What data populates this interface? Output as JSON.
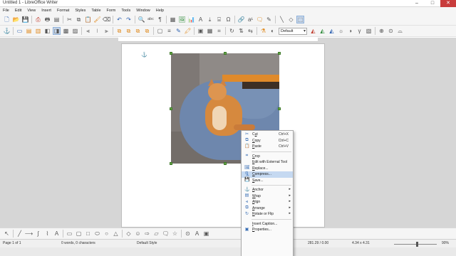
{
  "window": {
    "title": "Untitled 1 - LibreOffice Writer",
    "controls": [
      "–",
      "□",
      "✕"
    ]
  },
  "menubar": [
    "File",
    "Edit",
    "View",
    "Insert",
    "Format",
    "Styles",
    "Table",
    "Form",
    "Tools",
    "Window",
    "Help"
  ],
  "toolbar_top": [
    {
      "name": "new-document-icon",
      "glyph": "🗋",
      "tone": "blue"
    },
    {
      "name": "open-icon",
      "glyph": "📂",
      "tone": "orange"
    },
    {
      "name": "save-icon",
      "glyph": "💾",
      "tone": "blue"
    },
    {
      "sep": true
    },
    {
      "name": "export-pdf-icon",
      "glyph": "⎙",
      "tone": "red"
    },
    {
      "name": "print-icon",
      "glyph": "🖶",
      "tone": ""
    },
    {
      "name": "print-preview-icon",
      "glyph": "▤",
      "tone": ""
    },
    {
      "sep": true
    },
    {
      "name": "cut-icon",
      "glyph": "✂",
      "tone": ""
    },
    {
      "name": "copy-icon",
      "glyph": "⧉",
      "tone": ""
    },
    {
      "name": "paste-icon",
      "glyph": "📋",
      "tone": "orange"
    },
    {
      "name": "clone-formatting-icon",
      "glyph": "🖌",
      "tone": "orange"
    },
    {
      "name": "clear-formatting-icon",
      "glyph": "⌫",
      "tone": ""
    },
    {
      "sep": true
    },
    {
      "name": "undo-icon",
      "glyph": "↶",
      "tone": "blue"
    },
    {
      "name": "redo-icon",
      "glyph": "↷",
      "tone": "blue"
    },
    {
      "sep": true
    },
    {
      "name": "find-replace-icon",
      "glyph": "🔍",
      "tone": ""
    },
    {
      "name": "spelling-icon",
      "glyph": "ᵃᵇᶜ",
      "tone": ""
    },
    {
      "name": "formatting-marks-icon",
      "glyph": "¶",
      "tone": ""
    },
    {
      "sep": true
    },
    {
      "name": "insert-table-icon",
      "glyph": "▦",
      "tone": ""
    },
    {
      "name": "insert-image-icon",
      "glyph": "🖼",
      "tone": "green"
    },
    {
      "name": "insert-chart-icon",
      "glyph": "📊",
      "tone": "blue"
    },
    {
      "name": "insert-textbox-icon",
      "glyph": "A",
      "tone": ""
    },
    {
      "name": "insert-page-break-icon",
      "glyph": "⤓",
      "tone": ""
    },
    {
      "name": "insert-field-icon",
      "glyph": "⌸",
      "tone": ""
    },
    {
      "name": "insert-special-char-icon",
      "glyph": "Ω",
      "tone": ""
    },
    {
      "sep": true
    },
    {
      "name": "hyperlink-icon",
      "glyph": "🔗",
      "tone": "blue"
    },
    {
      "name": "footnote-icon",
      "glyph": "a¹",
      "tone": ""
    },
    {
      "name": "comment-icon",
      "glyph": "🗨",
      "tone": "orange"
    },
    {
      "name": "track-changes-icon",
      "glyph": "✎",
      "tone": ""
    },
    {
      "sep": true
    },
    {
      "name": "insert-line-icon",
      "glyph": "╲",
      "tone": ""
    },
    {
      "name": "basic-shapes-icon",
      "glyph": "◇",
      "tone": ""
    },
    {
      "name": "show-draw-functions-icon",
      "glyph": "⬚",
      "tone": "",
      "active": true
    }
  ],
  "toolbar_frame": [
    {
      "name": "anchor-icon",
      "glyph": "⚓",
      "tone": "blue"
    },
    {
      "sep": true
    },
    {
      "name": "wrap-off-icon",
      "glyph": "▭",
      "tone": "blue"
    },
    {
      "name": "page-wrap-icon",
      "glyph": "▤",
      "tone": "orange"
    },
    {
      "name": "optimal-wrap-icon",
      "glyph": "▥",
      "tone": "orange"
    },
    {
      "name": "wrap-left-icon",
      "glyph": "◧",
      "tone": ""
    },
    {
      "name": "wrap-right-icon",
      "glyph": "◨",
      "tone": "",
      "active": true
    },
    {
      "name": "wrap-through-icon",
      "glyph": "▩",
      "tone": ""
    },
    {
      "name": "in-background-icon",
      "glyph": "▨",
      "tone": ""
    },
    {
      "sep": true
    },
    {
      "name": "align-left-icon",
      "glyph": "⫷",
      "tone": ""
    },
    {
      "name": "align-center-icon",
      "glyph": "⧙",
      "tone": ""
    },
    {
      "name": "align-right-icon",
      "glyph": "⫸",
      "tone": ""
    },
    {
      "sep": true
    },
    {
      "name": "bring-to-front-icon",
      "glyph": "⧉",
      "tone": "orange"
    },
    {
      "name": "bring-forward-icon",
      "glyph": "⧉",
      "tone": "orange"
    },
    {
      "name": "send-backward-icon",
      "glyph": "⧉",
      "tone": "orange"
    },
    {
      "name": "send-to-back-icon",
      "glyph": "⧉",
      "tone": "orange"
    },
    {
      "sep": true
    },
    {
      "name": "border-icon",
      "glyph": "▢",
      "tone": ""
    },
    {
      "name": "border-style-icon",
      "glyph": "≡",
      "tone": ""
    },
    {
      "name": "border-color-icon",
      "glyph": "✎",
      "tone": "blue"
    },
    {
      "name": "background-color-icon",
      "glyph": "🖍",
      "tone": "orange"
    },
    {
      "sep": true
    },
    {
      "name": "frame-properties-icon",
      "glyph": "▣",
      "tone": ""
    },
    {
      "name": "image-properties-icon",
      "glyph": "▦",
      "tone": ""
    },
    {
      "name": "crop-icon",
      "glyph": "⌗",
      "tone": ""
    },
    {
      "sep": true
    },
    {
      "name": "rotate-icon",
      "glyph": "↻",
      "tone": ""
    },
    {
      "name": "flip-vertical-icon",
      "glyph": "⇅",
      "tone": ""
    },
    {
      "name": "flip-horizontal-icon",
      "glyph": "⇆",
      "tone": ""
    },
    {
      "sep": true
    },
    {
      "name": "image-filter-icon",
      "glyph": "⚗",
      "tone": "orange"
    },
    {
      "name": "graphics-mode-icon",
      "glyph": "◐",
      "tone": ""
    },
    {
      "combo": "Default"
    },
    {
      "name": "red-channel-icon",
      "glyph": "◭",
      "tone": "red"
    },
    {
      "name": "green-channel-icon",
      "glyph": "◭",
      "tone": "green"
    },
    {
      "name": "blue-channel-icon",
      "glyph": "◭",
      "tone": "blue"
    },
    {
      "name": "brightness-icon",
      "glyph": "☼",
      "tone": ""
    },
    {
      "name": "contrast-icon",
      "glyph": "◑",
      "tone": ""
    },
    {
      "name": "gamma-icon",
      "glyph": "γ",
      "tone": ""
    },
    {
      "name": "transparency-icon",
      "glyph": "▧",
      "tone": ""
    },
    {
      "sep": true
    },
    {
      "name": "glue-points-icon",
      "glyph": "⊕",
      "tone": ""
    },
    {
      "name": "points-icon",
      "glyph": "⊙",
      "tone": ""
    },
    {
      "name": "contour-icon",
      "glyph": "⌓",
      "tone": ""
    }
  ],
  "context_menu": {
    "items": [
      {
        "name": "cut",
        "icon": "✂",
        "pre": "C",
        "ul": "u",
        "post": "t",
        "shortcut": "Ctrl+X"
      },
      {
        "name": "copy",
        "icon": "⧉",
        "pre": "",
        "ul": "C",
        "post": "opy",
        "shortcut": "Ctrl+C"
      },
      {
        "name": "paste",
        "icon": "📋",
        "pre": "",
        "ul": "P",
        "post": "aste",
        "shortcut": "Ctrl+V"
      },
      {
        "sep": true
      },
      {
        "name": "crop",
        "icon": "⌗",
        "pre": "",
        "ul": "C",
        "post": "rop"
      },
      {
        "name": "edit-external",
        "icon": "",
        "pre": "",
        "ul": "E",
        "post": "dit with External Tool"
      },
      {
        "name": "replace",
        "icon": "🖼",
        "pre": "",
        "ul": "R",
        "post": "eplace..."
      },
      {
        "name": "compress",
        "icon": "🗜",
        "pre": "",
        "ul": "C",
        "post": "ompress...",
        "highlight": true
      },
      {
        "name": "save",
        "icon": "💾",
        "pre": "",
        "ul": "S",
        "post": "ave..."
      },
      {
        "sep": true
      },
      {
        "name": "anchor",
        "icon": "⚓",
        "pre": "",
        "ul": "A",
        "post": "nchor",
        "submenu": true
      },
      {
        "name": "wrap",
        "icon": "▤",
        "pre": "",
        "ul": "W",
        "post": "rap",
        "submenu": true
      },
      {
        "name": "align",
        "icon": "⫷",
        "pre": "",
        "ul": "A",
        "post": "lign",
        "submenu": true
      },
      {
        "name": "arrange",
        "icon": "⧉",
        "pre": "",
        "ul": "A",
        "post": "rrange",
        "submenu": true
      },
      {
        "name": "rotate-flip",
        "icon": "↻",
        "pre": "",
        "ul": "R",
        "post": "otate or Flip",
        "submenu": true
      },
      {
        "sep": true
      },
      {
        "name": "insert-caption",
        "icon": "",
        "pre": "",
        "ul": "I",
        "post": "nsert Caption..."
      },
      {
        "name": "properties",
        "icon": "▣",
        "pre": "",
        "ul": "P",
        "post": "roperties..."
      }
    ]
  },
  "draw_toolbar": [
    {
      "name": "select-icon",
      "glyph": "↖"
    },
    {
      "sep": true
    },
    {
      "name": "line-icon",
      "glyph": "╱"
    },
    {
      "name": "line-arrow-icon",
      "glyph": "⟶"
    },
    {
      "name": "curve-icon",
      "glyph": "∫"
    },
    {
      "name": "connector-icon",
      "glyph": "⌇"
    },
    {
      "name": "fontwork-icon",
      "glyph": "A"
    },
    {
      "sep": true
    },
    {
      "name": "rectangle-icon",
      "glyph": "▭"
    },
    {
      "name": "rounded-rectangle-icon",
      "glyph": "▢"
    },
    {
      "name": "square-icon",
      "glyph": "□"
    },
    {
      "name": "ellipse-icon",
      "glyph": "⬭"
    },
    {
      "name": "circle-icon",
      "glyph": "○"
    },
    {
      "name": "triangle-icon",
      "glyph": "△"
    },
    {
      "sep": true
    },
    {
      "name": "diamond-icon",
      "glyph": "◇"
    },
    {
      "name": "symbol-shapes-icon",
      "glyph": "☺"
    },
    {
      "name": "block-arrows-icon",
      "glyph": "⇨"
    },
    {
      "name": "flowchart-icon",
      "glyph": "▱"
    },
    {
      "name": "callouts-icon",
      "glyph": "🗨"
    },
    {
      "name": "stars-icon",
      "glyph": "☆"
    },
    {
      "sep": true
    },
    {
      "name": "points-toggle-icon",
      "glyph": "⊙"
    },
    {
      "name": "text-box-icon",
      "glyph": "A"
    },
    {
      "name": "extrusion-icon",
      "glyph": "▣"
    }
  ],
  "statusbar": {
    "page": "Page 1 of 1",
    "words": "0 words, 0 characters",
    "style": "Default Style",
    "position": "281.29 / 0.00",
    "size": "4.34 x 4.31",
    "zoom": "90%"
  },
  "ruler_label": "A",
  "colors": {
    "selection_handle": "#6aa94a",
    "menu_highlight": "#c5d9f1",
    "close_button": "#c83c3c"
  }
}
